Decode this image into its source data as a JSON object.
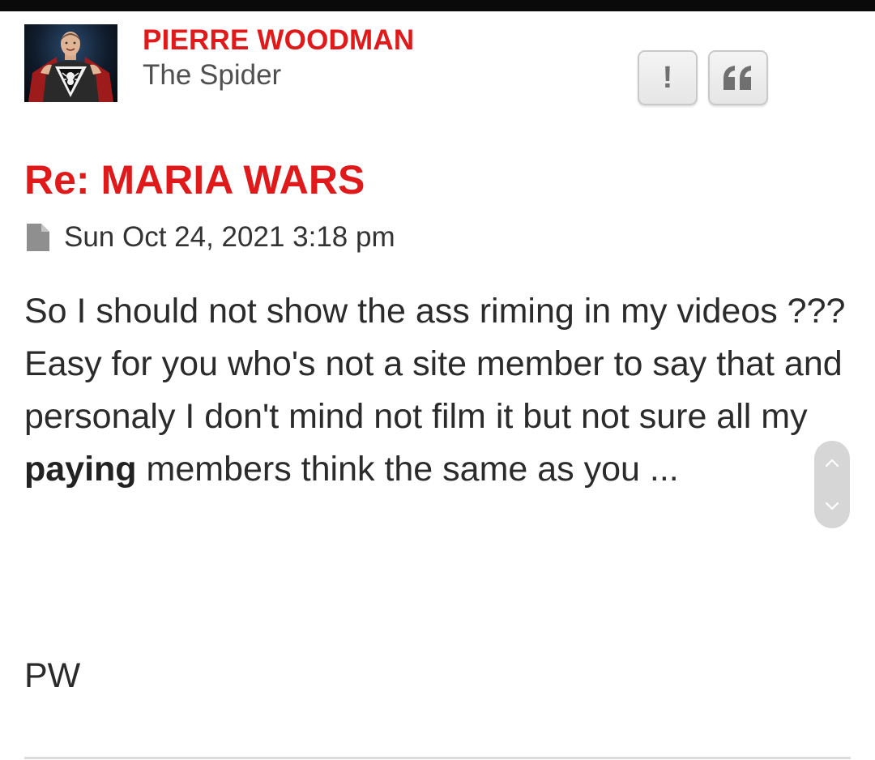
{
  "post": {
    "author": {
      "name": "PIERRE WOODMAN",
      "rank": "The Spider",
      "avatar_icon": "superhero-spider-avatar"
    },
    "actions": {
      "report_glyph": "!",
      "quote_glyph": "❝"
    },
    "title": "Re: MARIA WARS",
    "date_icon": "file-icon",
    "date": "Sun Oct 24, 2021 3:18 pm",
    "body": {
      "part1": "So I should not show the ass riming in my videos ??? Easy for you who's not a site member to say that and personaly I don't mind not film it but not sure all my ",
      "bold": "paying",
      "part2": " members think the same as you ..."
    },
    "signature": "PW"
  },
  "colors": {
    "accent": "#e01a1a",
    "text": "#2b2b2b",
    "muted": "#505050",
    "button_bg": "#eeeeee",
    "button_border": "#c9c9c9"
  }
}
